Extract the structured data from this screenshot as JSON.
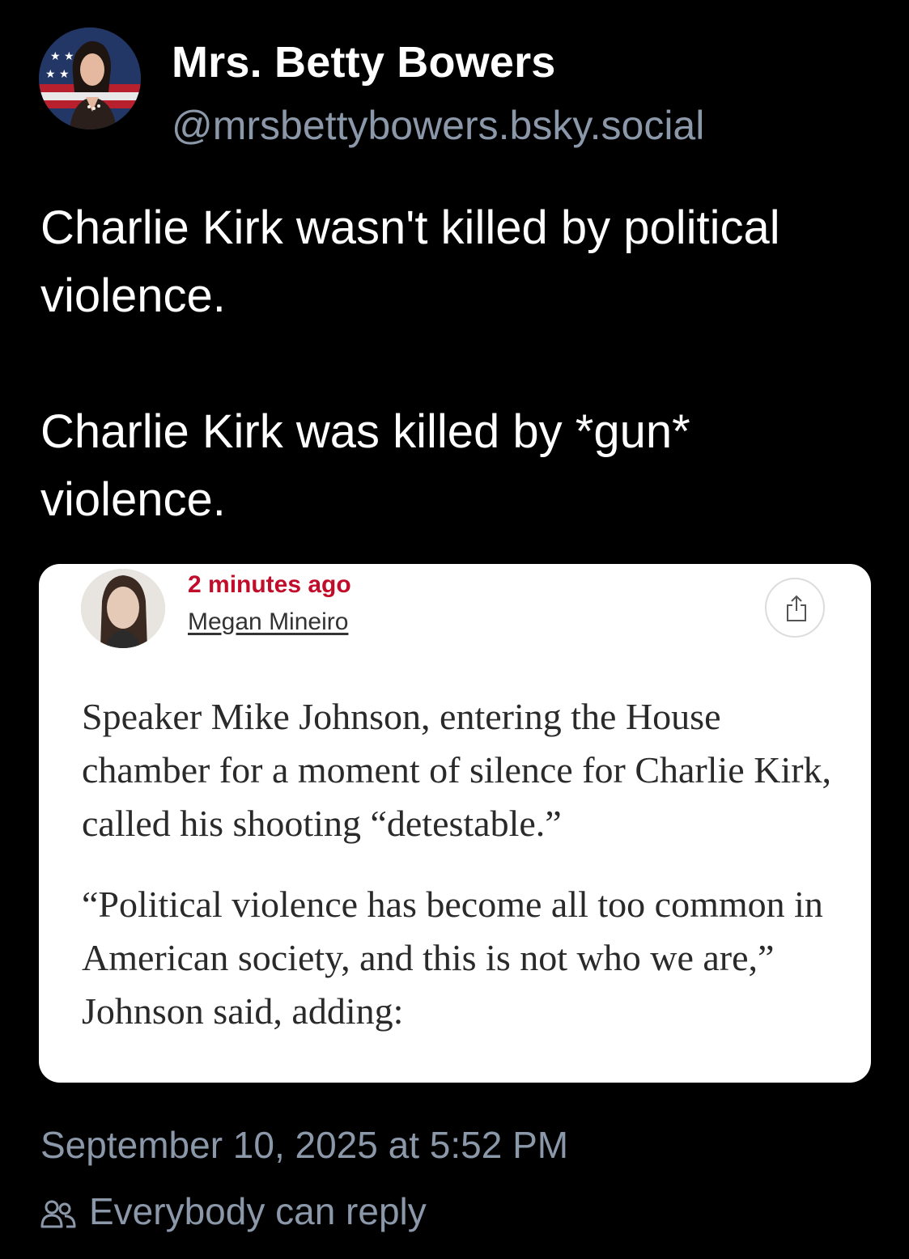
{
  "post": {
    "author": {
      "display_name": "Mrs. Betty Bowers",
      "handle": "@mrsbettybowers.bsky.social",
      "avatar_icon": "profile-photo"
    },
    "text_paragraphs": [
      "Charlie Kirk wasn't killed by political violence.",
      "Charlie Kirk was killed by *gun* violence."
    ],
    "timestamp": "September 10, 2025 at 5:52 PM",
    "reply_setting": "Everybody can reply",
    "reply_icon": "people-icon"
  },
  "embed": {
    "time_ago": "2 minutes ago",
    "author": "Megan Mineiro",
    "share_icon": "share-icon",
    "paragraphs": [
      "Speaker Mike Johnson, entering the House chamber for a moment of silence for Charlie Kirk, called his shooting “detestable.”",
      "“Political violence has become all too common in American society, and this is not who we are,” Johnson said, adding:"
    ]
  },
  "colors": {
    "background": "#000000",
    "secondary_text": "#8b98aa",
    "embed_time_red": "#c10d2a"
  }
}
